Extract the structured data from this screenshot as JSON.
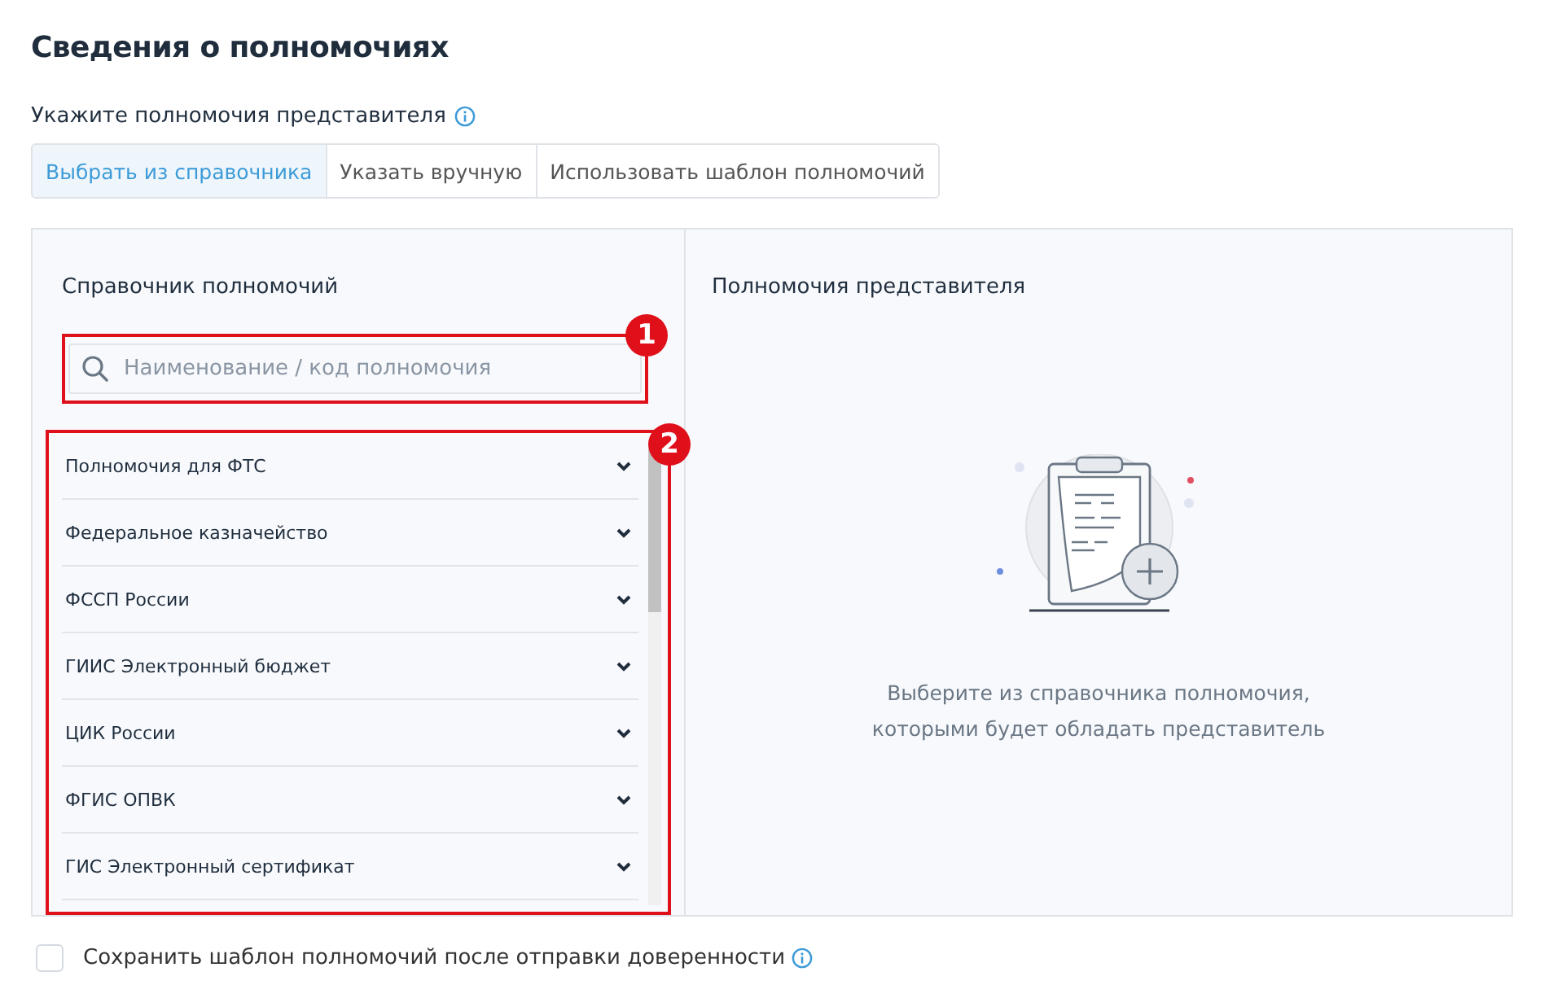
{
  "title": "Сведения о полномочиях",
  "subtitle": "Укажите полномочия представителя",
  "tabs": [
    {
      "label": "Выбрать из справочника",
      "selected": true
    },
    {
      "label": "Указать вручную",
      "selected": false
    },
    {
      "label": "Использовать шаблон полномочий",
      "selected": false
    }
  ],
  "catalog": {
    "heading": "Справочник полномочий",
    "search": {
      "placeholder": "Наименование / код полномочия"
    },
    "items": [
      {
        "label": "Полномочия для ФТС",
        "expanded": false
      },
      {
        "label": "Федеральное казначейство",
        "expanded": false
      },
      {
        "label": "ФССП России",
        "expanded": false
      },
      {
        "label": "ГИИС Электронный бюджет",
        "expanded": false
      },
      {
        "label": "ЦИК России",
        "expanded": false
      },
      {
        "label": "ФГИС ОПВК",
        "expanded": false
      },
      {
        "label": "ГИС Электронный сертификат",
        "expanded": false
      }
    ]
  },
  "selected_panel": {
    "heading": "Полномочия представителя",
    "empty_text": "Выберите из справочника полномочия, которыми будет обладать представитель"
  },
  "callouts": [
    "1",
    "2"
  ],
  "save_template": {
    "label": "Сохранить шаблон полномочий после отправки доверенности",
    "checked": false
  }
}
